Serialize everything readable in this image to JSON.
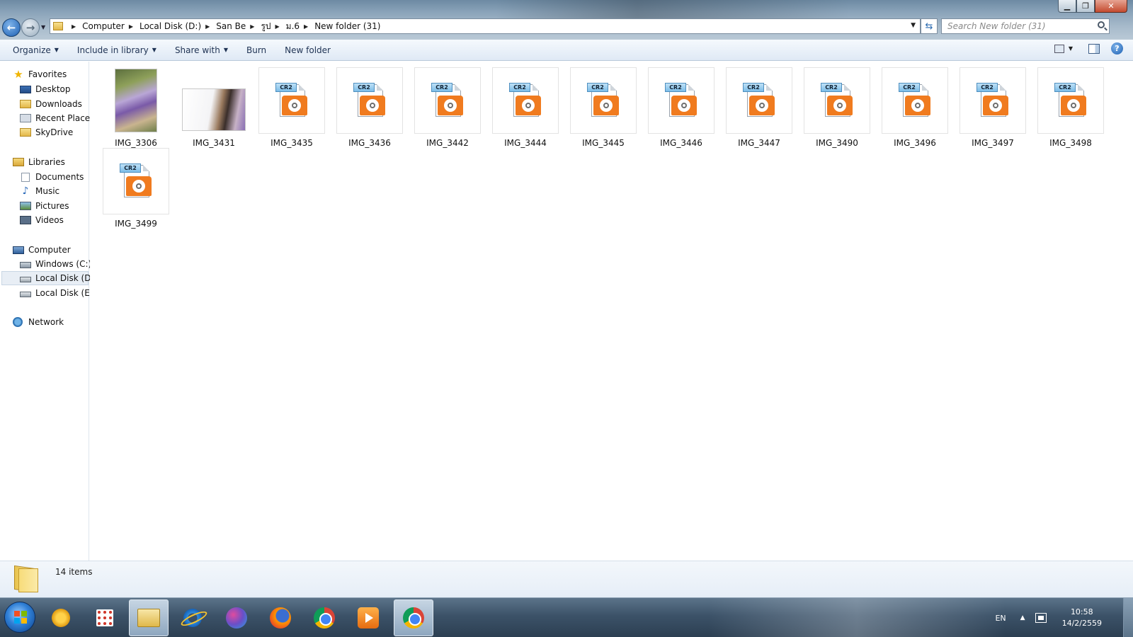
{
  "window": {
    "controls": {
      "minimize": "▁",
      "maximize": "❐",
      "close": "✕"
    }
  },
  "address": {
    "crumbs": [
      "Computer",
      "Local Disk (D:)",
      "San Be",
      "รูป",
      "ม.6",
      "New folder (31)"
    ],
    "search_placeholder": "Search New folder (31)"
  },
  "toolbar": {
    "organize": "Organize",
    "include_in_library": "Include in library",
    "share_with": "Share with",
    "burn": "Burn",
    "new_folder": "New folder",
    "help": "?"
  },
  "nav": {
    "favorites": {
      "label": "Favorites",
      "items": [
        "Desktop",
        "Downloads",
        "Recent Places",
        "SkyDrive"
      ]
    },
    "libraries": {
      "label": "Libraries",
      "items": [
        "Documents",
        "Music",
        "Pictures",
        "Videos"
      ]
    },
    "computer": {
      "label": "Computer",
      "items": [
        "Windows (C:)",
        "Local Disk (D:)",
        "Local Disk (E:)"
      ],
      "selected": "Local Disk (D:)"
    },
    "network": {
      "label": "Network"
    }
  },
  "files": [
    {
      "name": "IMG_3306",
      "type": "photo-portrait"
    },
    {
      "name": "IMG_3431",
      "type": "photo-landscape"
    },
    {
      "name": "IMG_3435",
      "type": "CR2"
    },
    {
      "name": "IMG_3436",
      "type": "CR2"
    },
    {
      "name": "IMG_3442",
      "type": "CR2"
    },
    {
      "name": "IMG_3444",
      "type": "CR2"
    },
    {
      "name": "IMG_3445",
      "type": "CR2"
    },
    {
      "name": "IMG_3446",
      "type": "CR2"
    },
    {
      "name": "IMG_3447",
      "type": "CR2"
    },
    {
      "name": "IMG_3490",
      "type": "CR2"
    },
    {
      "name": "IMG_3496",
      "type": "CR2"
    },
    {
      "name": "IMG_3497",
      "type": "CR2"
    },
    {
      "name": "IMG_3498",
      "type": "CR2"
    },
    {
      "name": "IMG_3499",
      "type": "CR2"
    }
  ],
  "cr2_tag": "CR2",
  "status": {
    "item_count": "14 items"
  },
  "taskbar": {
    "apps": [
      "keys",
      "tiles",
      "windows-explorer",
      "internet-explorer",
      "s-app",
      "firefox",
      "chrome",
      "media-player",
      "chrome"
    ],
    "active_app": "windows-explorer",
    "language": "EN",
    "time": "10:58",
    "date": "14/2/2559"
  }
}
